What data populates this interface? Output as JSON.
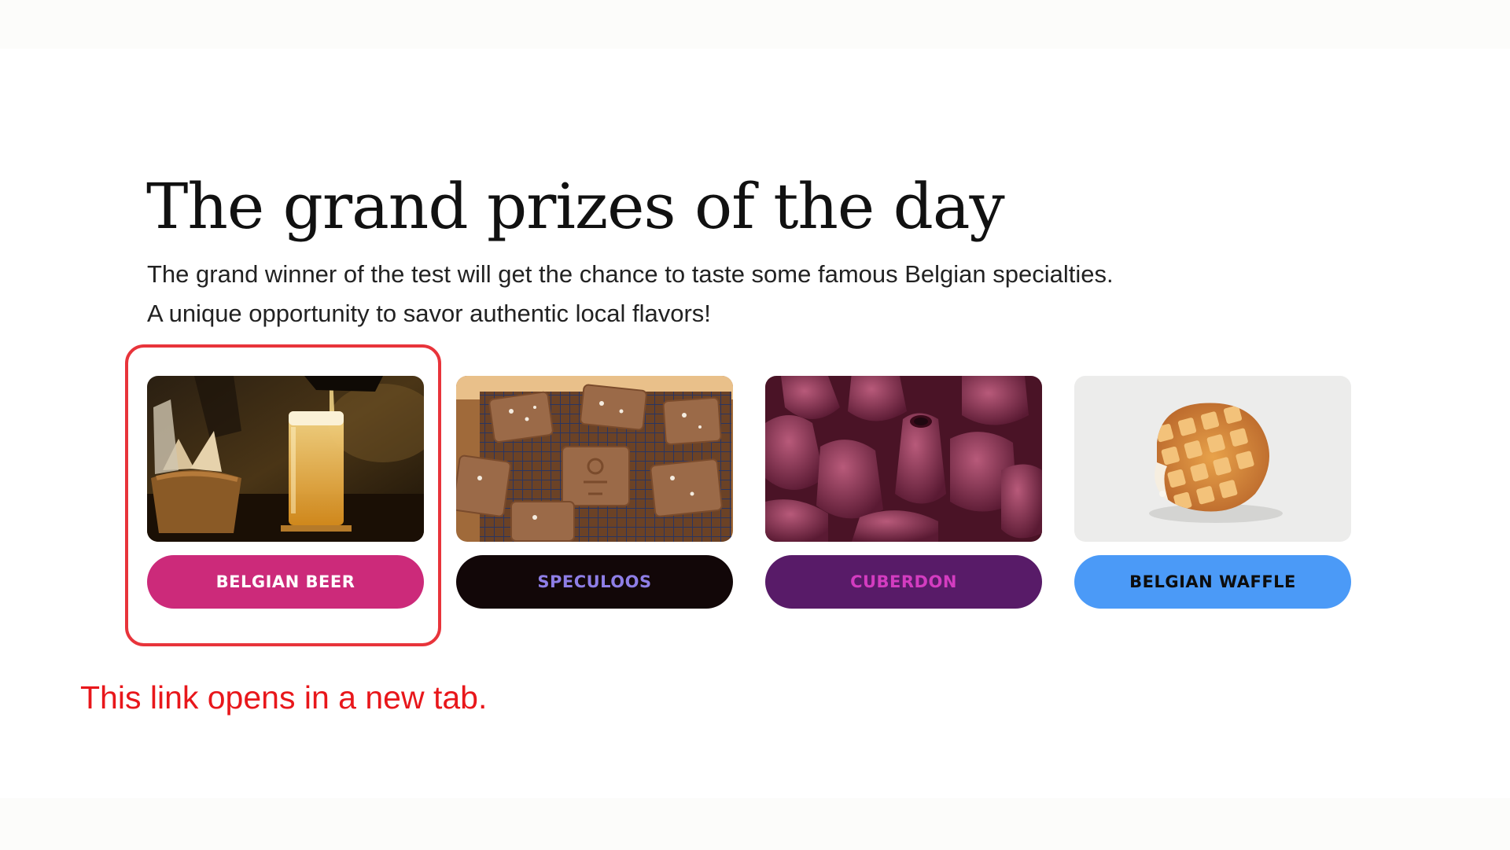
{
  "page": {
    "title": "The grand prizes of the day",
    "description_lines": [
      "The grand winner of the test will get the chance to taste some famous Belgian specialties.",
      "A unique opportunity to savor authentic local flavors!"
    ]
  },
  "prizes": [
    {
      "label": "BELGIAN BEER",
      "image": "belgian-beer-photo",
      "button_bg": "#cc2a7a",
      "button_fg": "#ffffff"
    },
    {
      "label": "SPECULOOS",
      "image": "speculoos-photo",
      "button_bg": "#120708",
      "button_fg": "#8e7ee6"
    },
    {
      "label": "CUBERDON",
      "image": "cuberdon-photo",
      "button_bg": "#581b68",
      "button_fg": "#d33cc0"
    },
    {
      "label": "BELGIAN WAFFLE",
      "image": "belgian-waffle-photo",
      "button_bg": "#4b9af7",
      "button_fg": "#0d0d0d"
    }
  ],
  "annotation": {
    "text": "This link opens in a new tab.",
    "color": "#e8171b",
    "highlight_color": "#e8343b"
  }
}
